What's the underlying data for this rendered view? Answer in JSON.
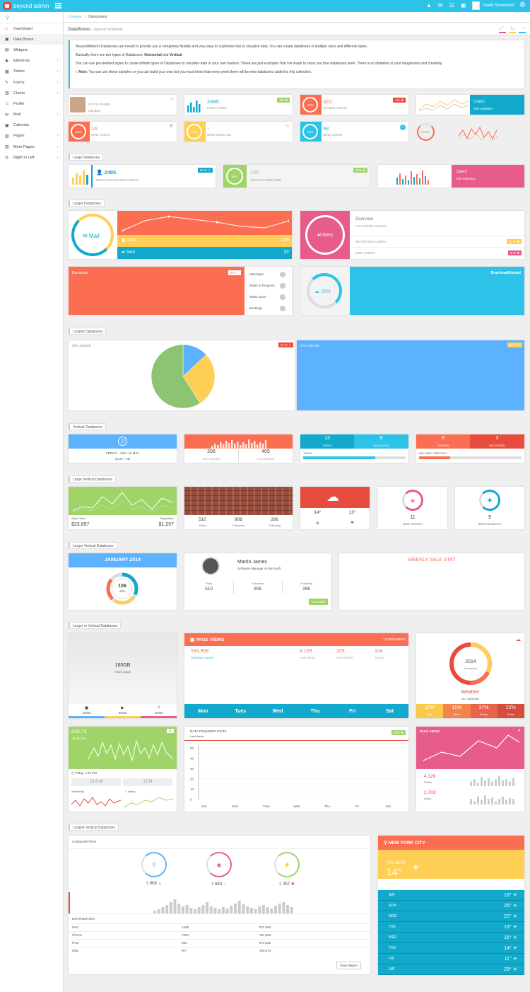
{
  "brand": "beyond admin",
  "topbar": {
    "user": "David Stevenson",
    "icons": [
      "warning-icon",
      "mail-icon",
      "chat-icon",
      "calendar-icon"
    ]
  },
  "sidebar": {
    "items": [
      {
        "label": "Dashboard",
        "icon": "home-icon",
        "has_arrow": false
      },
      {
        "label": "Data Boxes",
        "icon": "box-icon",
        "has_arrow": false,
        "active": true
      },
      {
        "label": "Widgets",
        "icon": "widgets-icon",
        "has_arrow": false
      },
      {
        "label": "Elements",
        "icon": "elements-icon",
        "has_arrow": true
      },
      {
        "label": "Tables",
        "icon": "table-icon",
        "has_arrow": true
      },
      {
        "label": "Forms",
        "icon": "pencil-icon",
        "has_arrow": true
      },
      {
        "label": "Charts",
        "icon": "chart-icon",
        "has_arrow": true
      },
      {
        "label": "Profile",
        "icon": "profile-icon",
        "has_arrow": false
      },
      {
        "label": "Mail",
        "icon": "mail-icon",
        "has_arrow": true
      },
      {
        "label": "Calendar",
        "icon": "calendar-icon",
        "has_arrow": false
      },
      {
        "label": "Pages",
        "icon": "pages-icon",
        "has_arrow": true
      },
      {
        "label": "More Pages",
        "icon": "more-icon",
        "has_arrow": true
      },
      {
        "label": "Right to Left",
        "icon": "rtl-icon",
        "has_arrow": true
      }
    ]
  },
  "breadcrumb": {
    "home": "Home",
    "current": "Databoxes"
  },
  "page_header": {
    "title": "DataBoxes",
    "subtitle": "beyond containers"
  },
  "intro": {
    "p1": "BeyondAdmin's Databoxes are meant to provide you a completely flexible and very easy to customize tool to visualize data. You can create databoxes in multiple sizes and different styles.",
    "p2a": "Basically there are two types of Databoxes: ",
    "p2b": "Horizontal",
    "p2c": " and ",
    "p2d": "Vertical",
    "p3": "You can use pre-defined styles to create infinite types of Databoxes to visualize data in your own fashion. These are just examples that i've made to show you how databoxes work. There is no limitation in your imagination and creativity.",
    "note_label": "Note:",
    "note": " You can use these samples or you can build your own but you must know that every week there will be new databoxes added to this collection."
  },
  "small": {
    "profile_name": "DIVYIA JONES",
    "profile_role": "Manager",
    "pageviews": "2485",
    "pageviews_label": "PAGE VIEWS",
    "pageviews_badge": "8% ✚",
    "unique": "322",
    "unique_label": "UNIQUE USERS",
    "unique_pct": "42%",
    "unique_badge": "4% ✚",
    "users": "Users",
    "visit": "Visit Statistics",
    "tasks": "14",
    "tasks_label": "NEW TASKS",
    "tasks_pct": "50%",
    "msg": "1",
    "msg_label": "NEW MESSAGE",
    "msg_pct": "15%",
    "newusers": "98",
    "newusers_label": "NEW USERS",
    "newusers_pct": "76%",
    "visits": "VISITS"
  },
  "large": {
    "tag": "Large Databoxes",
    "users": "2485",
    "users_label": "NEW & RETURNING USERS",
    "badge1": "10 % ⇧",
    "traffic": "206",
    "traffic_label": "TRAFFIC USED (GB)",
    "traffic_pct": "50%",
    "badge2": "10% ✚",
    "users2": "Users",
    "visit2": "Visit Statistics"
  },
  "larger": {
    "tag": "Larger Databoxes",
    "mail": "Mail",
    "inbox": "Inbox",
    "inbox_n": "129",
    "sent": "Sent",
    "sent_n": "32",
    "users": "Users",
    "overview": "Overview",
    "overview_sub": "Your website statistics",
    "returning": "RETURNING USERS",
    "returning_badge": "12 % ✚",
    "newusers": "NEW USERS",
    "newusers_badge": "8 % ✚",
    "burndown": "Burndown",
    "burn_badge": "8% ⇧",
    "msgs": "Messages",
    "tip": "Tasks In Progress",
    "done": "Tasks Done",
    "backlogs": "Backlogs",
    "dl_pct": "25%",
    "download": "Download/Upload"
  },
  "largest": {
    "tag": "Largest Databoxes",
    "cpu1": "CPU USAGE",
    "cpu1_badge": "24 % ⇩",
    "cpu2": "CPU USAGE",
    "cpu2_badge": "16 % ⇧"
  },
  "pie": {
    "slices": [
      {
        "value": 13,
        "color": "#5db2ff"
      },
      {
        "value": 28,
        "color": "#ffce55"
      },
      {
        "value": 59,
        "color": "#8cc474"
      }
    ]
  },
  "vertical": {
    "tag": "Vertical Databoxes",
    "date": "FRIDAY - 2014 16 MAY",
    "time": "11:24 - AM",
    "followers": "206",
    "followers_l": "FOLLOWERS",
    "following": "405",
    "following_l": "FOLLOWING",
    "tasks": "13",
    "tasks_l": "TASKS",
    "backlogs": "9",
    "backlogs_l": "BACKLOGS",
    "tasks_bar": "TASKS",
    "orders": "9",
    "orders_l": "ORDERS",
    "delivered": "3",
    "delivered_l": "DELIVERED",
    "delivery": "DELIVERY PERCENT"
  },
  "lv": {
    "tag": "Large Vertical Databoxes",
    "sales_total": "Sales Total",
    "sales_v": "$23,657",
    "sep": "September",
    "sep_v": "$1,257",
    "posts": "510",
    "posts_l": "Posts",
    "fol": "908",
    "fol_l": "Followers",
    "fing": "286",
    "fing_l": "Following",
    "t1": "14°",
    "t2": "13°",
    "tickets": "11",
    "tickets_l": "NEW TICKETS",
    "products": "9",
    "products_l": "NEW PRODUCTS"
  },
  "lv2": {
    "tag": "Larger Vertical Databoxes",
    "jan": "JANUARY 2014",
    "num": "106",
    "pct": "40%",
    "name": "Martin James",
    "role": "Software Manager at Microsoft",
    "posts": "510",
    "posts_l": "Posts",
    "fol": "908",
    "fol_l": "Followers",
    "fing": "286",
    "fing_l": "Following",
    "follow": "FOLLOW",
    "weekly": "WEEKLY SALE STAT"
  },
  "lv3": {
    "tag": "Larger er Vertical Databoxes",
    "storage": "160GB",
    "storage_l": "Total Usage",
    "s1": "50GB",
    "s2": "80GB",
    "s3": "30GB",
    "pv": "PAGE VIEWS",
    "pv_date": "13 DECEMBER",
    "overall": "534,908",
    "overall_l": "OVERALL VIEWS",
    "week": "4,129",
    "week_l": "THIS WEEK",
    "yest": "329",
    "yest_l": "YESTERDAY",
    "today": "104",
    "today_l": "TODAY",
    "days": [
      "Mon",
      "Tues",
      "Wed",
      "Thu",
      "Fri",
      "Sat"
    ],
    "year": "2014",
    "december": "December",
    "weather": "Weather",
    "season": "ALL SEASON",
    "w": [
      {
        "v": "30%",
        "l": "Rain",
        "c": "#fbc84c"
      },
      {
        "v": "11%",
        "l": "Wind",
        "c": "#f2844b"
      },
      {
        "v": "37%",
        "l": "Sunny",
        "c": "#e8634b"
      },
      {
        "v": "22%",
        "l": "Snow",
        "c": "#d64d3e"
      }
    ],
    "green_v": "639,73",
    "green_pct": "-39 (4.2%)",
    "today_t": "Today, 4:15 PM",
    "m1": "16.8 M",
    "m2": "12 M",
    "monthly": "Monthly",
    "yearly": "Yearly",
    "dt": "DATA TRANSFER STATS",
    "lastweek": "Last Week",
    "dt_badge": "58% ✚",
    "yticks": [
      "50",
      "40",
      "30",
      "20",
      "10",
      "0"
    ],
    "xdays": [
      "Sun",
      "Mon",
      "Tues",
      "Wed",
      "Thu",
      "Fri",
      "Sat"
    ],
    "pv2": "PAGE VIEWS",
    "profile_v": "4,129",
    "profile_l": "Profile",
    "about_v": "2,703",
    "about_l": "About"
  },
  "lv4": {
    "tag": "Largest Vertical Databoxes",
    "consumption": "CONSUMPTION",
    "c1": "909",
    "c2": "643",
    "c3": "257",
    "dollar": "$",
    "distribution": "DISTRIBUTION",
    "rows": [
      [
        "iPad",
        "1208",
        "874,993"
      ],
      [
        "iPhone",
        "7064",
        "761,083"
      ],
      [
        "iPod",
        "903",
        "874,832"
      ],
      [
        "iMac",
        "907",
        "165,973"
      ]
    ],
    "save": "Save Report",
    "city": "NEW YORK CITY",
    "date": "FRI 29/09",
    "temp": "14°",
    "forecast": [
      [
        "SAT",
        "18°"
      ],
      [
        "SUN",
        "25°"
      ],
      [
        "MON",
        "22°"
      ],
      [
        "TUE",
        "19°"
      ],
      [
        "WED",
        "16°"
      ],
      [
        "THU",
        "14°"
      ],
      [
        "FRI",
        "11°"
      ],
      [
        "SAT",
        "29°"
      ]
    ]
  },
  "colors": {
    "blue": "#2dc3e8",
    "red": "#fb6e52",
    "yellow": "#ffce55",
    "green": "#a0d468",
    "pink": "#e75b8d",
    "darkblue": "#11a9cc",
    "sky": "#5db2ff"
  }
}
